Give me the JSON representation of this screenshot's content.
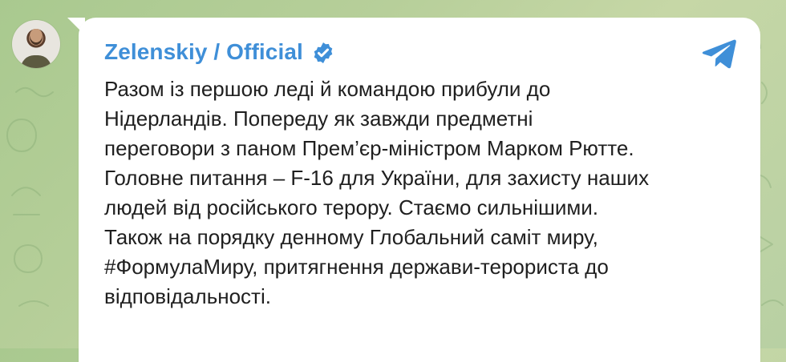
{
  "channel": {
    "name": "Zelenskiy / Official",
    "verified_icon": "verified-icon",
    "telegram_icon": "telegram-icon",
    "accent": "#3f8fd8"
  },
  "message": {
    "text": "Разом із першою леді й командою прибули до\nНідерландів. Попереду як завжди предметні\nпереговори з паном Прем’єр-міністром Марком Рютте.\nГоловне питання – F-16 для України, для захисту наших\nлюдей від російського терору. Стаємо сильнішими.\nТакож на порядку денному Глобальний саміт миру,\n#ФормулаМиру, притягнення держави-терориста до\nвідповідальності."
  }
}
